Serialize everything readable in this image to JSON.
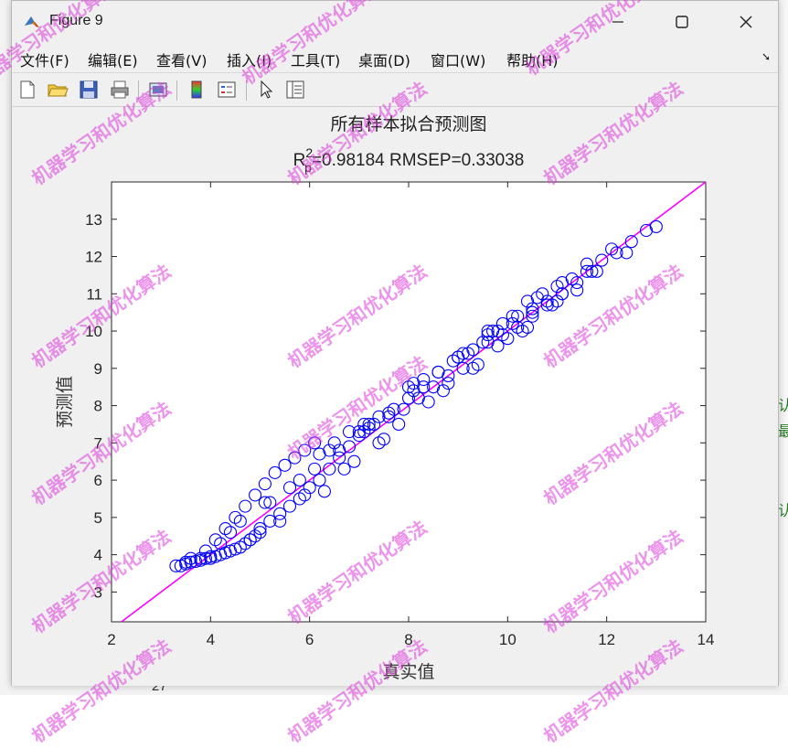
{
  "window": {
    "title": "Figure 9"
  },
  "menu": [
    "文件(F)",
    "编辑(E)",
    "查看(V)",
    "插入(I)",
    "工具(T)",
    "桌面(D)",
    "窗口(W)",
    "帮助(H)"
  ],
  "toolbar_icons": [
    "new-file-icon",
    "open-folder-icon",
    "save-icon",
    "print-icon",
    "print-preview-icon",
    "colorbar-icon",
    "legend-icon",
    "pointer-icon",
    "property-editor-icon"
  ],
  "watermark_text": "机器学习和优化算法",
  "background": {
    "page_number": "27",
    "glyphs": [
      "认",
      "最",
      "认"
    ]
  },
  "chart_data": {
    "type": "scatter",
    "title": "所有样本拟合预测图",
    "subtitle": {
      "r_base": "R",
      "r_sup": "2",
      "r_sub": "p",
      "r_value": "=0.98184",
      "rmsep": "RMSEP=0.33038"
    },
    "xlabel": "真实值",
    "ylabel": "预测值",
    "xlim": [
      2,
      14
    ],
    "ylim": [
      2.2,
      14
    ],
    "xticks": [
      2,
      4,
      6,
      8,
      10,
      12,
      14
    ],
    "yticks": [
      3,
      4,
      5,
      6,
      7,
      8,
      9,
      10,
      11,
      12,
      13
    ],
    "series": [
      {
        "marker": "circle",
        "color": "#0000ff",
        "x": [
          3.3,
          3.4,
          3.5,
          3.6,
          3.7,
          3.8,
          3.9,
          4.0,
          4.1,
          4.2,
          4.3,
          4.4,
          4.5,
          4.6,
          4.7,
          4.8,
          4.9,
          5.0,
          3.9,
          4.1,
          4.3,
          4.5,
          4.7,
          4.9,
          5.1,
          5.3,
          5.5,
          5.7,
          5.9,
          6.1,
          5.0,
          5.2,
          5.4,
          5.6,
          5.8,
          6.0,
          6.2,
          6.4,
          6.6,
          6.8,
          7.0,
          7.2,
          6.2,
          6.5,
          6.8,
          7.1,
          7.4,
          7.7,
          8.0,
          8.3,
          7.0,
          7.3,
          7.6,
          7.9,
          8.2,
          8.5,
          8.8,
          9.1,
          8.0,
          8.3,
          8.6,
          8.9,
          9.2,
          9.5,
          9.8,
          10.1,
          9.0,
          9.3,
          9.6,
          9.9,
          10.2,
          10.5,
          10.8,
          11.1,
          9.6,
          9.9,
          10.2,
          10.5,
          10.8,
          11.1,
          11.4,
          11.7,
          10.4,
          10.7,
          11.0,
          11.3,
          11.6,
          11.9,
          12.2,
          12.5,
          12.8,
          13.0,
          4.6,
          5.1,
          5.6,
          6.1,
          6.6,
          7.1,
          7.6,
          8.1,
          8.6,
          9.1,
          9.6,
          10.1,
          10.6,
          11.1,
          11.6,
          12.1,
          3.5,
          4.0,
          4.8,
          5.4,
          6.3,
          7.4,
          8.4,
          9.4,
          10.4,
          11.4,
          12.4,
          6.9,
          7.8,
          8.8,
          9.8,
          10.9,
          11.8,
          5.9,
          6.7,
          7.5,
          8.7,
          9.3,
          10.0,
          10.3,
          11.0,
          3.6,
          3.8,
          4.2,
          4.4,
          5.2,
          5.8,
          6.4,
          7.2,
          8.1,
          9.0,
          9.7,
          10.5
        ],
        "y": [
          3.7,
          3.7,
          3.75,
          3.8,
          3.82,
          3.85,
          3.9,
          3.9,
          3.95,
          4.0,
          4.05,
          4.1,
          4.15,
          4.2,
          4.3,
          4.4,
          4.5,
          4.7,
          4.1,
          4.4,
          4.7,
          5.0,
          5.3,
          5.6,
          5.9,
          6.2,
          6.4,
          6.6,
          6.8,
          7.0,
          4.6,
          4.9,
          5.1,
          5.3,
          5.5,
          5.8,
          6.0,
          6.3,
          6.6,
          6.9,
          7.2,
          7.4,
          6.7,
          7.0,
          7.3,
          7.5,
          7.7,
          7.9,
          8.2,
          8.5,
          7.3,
          7.5,
          7.7,
          7.9,
          8.2,
          8.5,
          8.8,
          9.0,
          8.5,
          8.7,
          8.9,
          9.2,
          9.4,
          9.7,
          10.0,
          10.2,
          9.3,
          9.5,
          9.7,
          9.9,
          10.1,
          10.4,
          10.7,
          11.0,
          10.0,
          10.2,
          10.4,
          10.5,
          10.8,
          11.0,
          11.3,
          11.6,
          10.8,
          11.0,
          11.2,
          11.4,
          11.6,
          11.9,
          12.1,
          12.4,
          12.7,
          12.8,
          4.9,
          5.4,
          5.8,
          6.3,
          6.8,
          7.3,
          7.8,
          8.4,
          8.9,
          9.4,
          9.9,
          10.4,
          10.9,
          11.3,
          11.8,
          12.2,
          3.8,
          3.95,
          4.4,
          4.9,
          5.7,
          7.0,
          8.1,
          9.1,
          10.1,
          11.1,
          12.1,
          6.5,
          7.5,
          8.6,
          9.6,
          10.7,
          11.6,
          5.6,
          6.3,
          7.1,
          8.4,
          9.0,
          9.8,
          10.0,
          10.8,
          3.9,
          3.9,
          4.3,
          4.6,
          5.4,
          6.0,
          6.8,
          7.5,
          8.6,
          9.3,
          10.0,
          10.6
        ]
      }
    ],
    "reference_line": {
      "type": "y=x",
      "color": "#ff00ff"
    },
    "grid": false
  }
}
